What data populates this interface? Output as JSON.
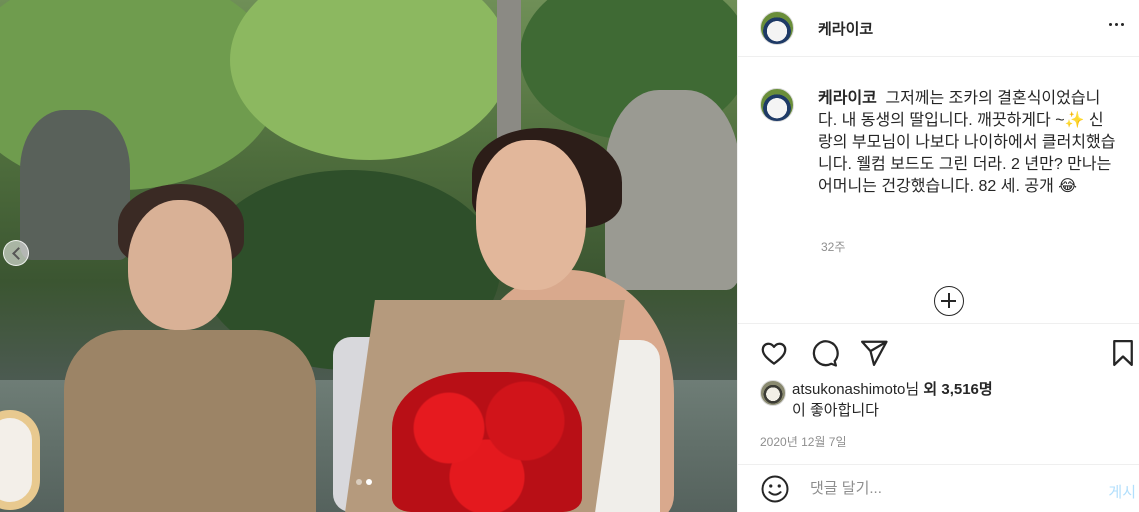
{
  "post": {
    "username": "케라이코",
    "caption": "그저께는 조카의 결혼식이었습니다. 내 동생의 딸입니다. 깨끗하게다 ~✨ 신랑의 부모님이 나보다 나이하에서 클러치했습니다. 웰컴 보드도 그린 더라. 2 년만? 만나는 어머니는 건강했습니다. 82 세. 공개 😂",
    "caption_time": "32주",
    "carousel": {
      "current": 2,
      "total": 2
    }
  },
  "likes": {
    "liker": "atsukonashimoto",
    "suffix_1": "님 ",
    "conjunction": "외",
    "count": "3,516명",
    "suffix_2": "이 좋아합니다"
  },
  "date": "2020년 12월 7일",
  "comment": {
    "placeholder": "댓글 달기...",
    "post_label": "게시"
  },
  "icons": {
    "more": "more-options-icon",
    "load_more": "plus-circle-icon",
    "like": "heart-icon",
    "comment": "comment-bubble-icon",
    "share": "paper-plane-icon",
    "save": "bookmark-icon",
    "emoji": "smile-icon"
  },
  "colors": {
    "text": "#262626",
    "secondary": "#8e8e8e",
    "divider": "#efefef",
    "post_button": "#b2dffc"
  }
}
